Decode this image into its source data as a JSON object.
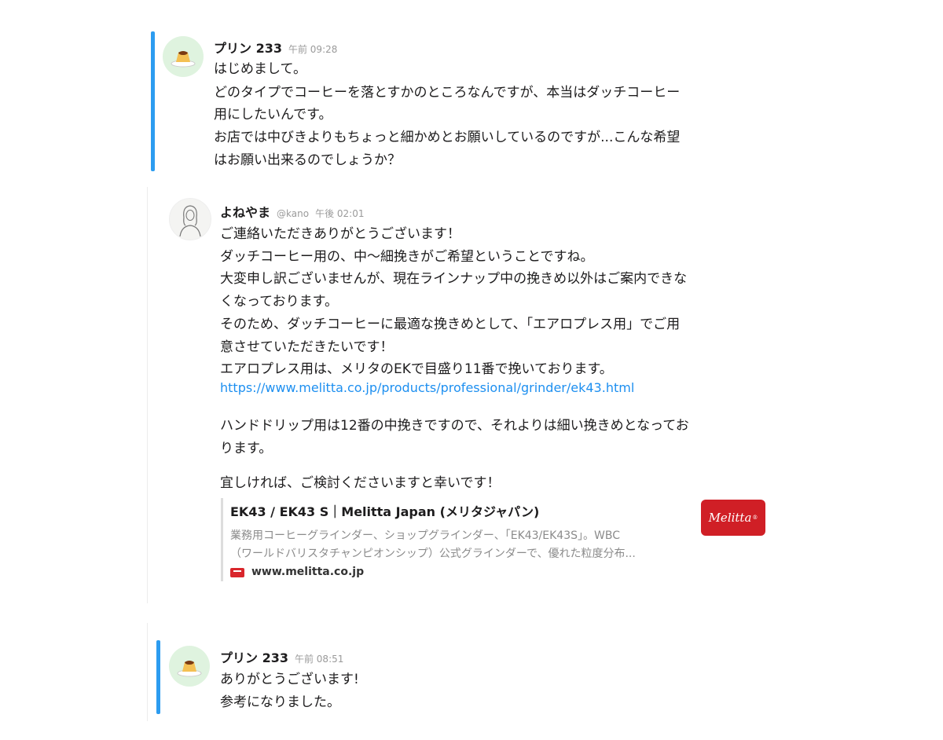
{
  "messages": [
    {
      "author": "プリン 233",
      "time": "午前 09:28",
      "lines": [
        "はじめまして。",
        "どのタイプでコーヒーを落とすかのところなんですが、本当はダッチコーヒー",
        "用にしたいんです。",
        "お店では中びきよりもちょっと細かめとお願いしているのですが...こんな希望",
        "はお願い出来るのでしょうか？"
      ]
    },
    {
      "author": "よねやま",
      "handle": "@kano",
      "time": "午後 02:01",
      "lines": [
        "ご連絡いただきありがとうございます！",
        "ダッチコーヒー用の、中〜細挽きがご希望ということですね。",
        "大変申し訳ございませんが、現在ラインナップ中の挽きめ以外はご案内できな",
        "くなっております。",
        "そのため、ダッチコーヒーに最適な挽きめとして、「エアロプレス用」でご用",
        "意させていただきたいです！",
        "エアロプレス用は、メリタのEKで目盛り11番で挽いております。"
      ],
      "link": "https://www.melitta.co.jp/products/professional/grinder/ek43.html",
      "lines2": [
        "ハンドドリップ用は12番の中挽きですので、それよりは細い挽きめとなってお",
        "ります。"
      ],
      "lines3": [
        "宜しければ、ご検討くださいますと幸いです！"
      ],
      "preview": {
        "title": "EK43 / EK43 S｜Melitta Japan (メリタジャパン)",
        "desc1": "業務用コーヒーグラインダー、ショップグラインダー、「EK43/EK43S」。WBC",
        "desc2": "（ワールドバリスタチャンピオンシップ）公式グラインダーで、優れた粒度分布...",
        "domain": "www.melitta.co.jp",
        "thumb_text": "Melitta",
        "thumb_mark": "®"
      }
    },
    {
      "author": "プリン 233",
      "time": "午前 08:51",
      "lines": [
        "ありがとうございます!",
        "参考になりました。"
      ]
    }
  ],
  "colors": {
    "accent_bar": "#2c9cf0",
    "link": "#1d8ff0",
    "brand_red": "#d01f26"
  },
  "icons": {
    "pudding_avatar": "pudding-icon",
    "person_avatar": "woman-sketch-icon",
    "favicon": "melitta-favicon-icon"
  }
}
